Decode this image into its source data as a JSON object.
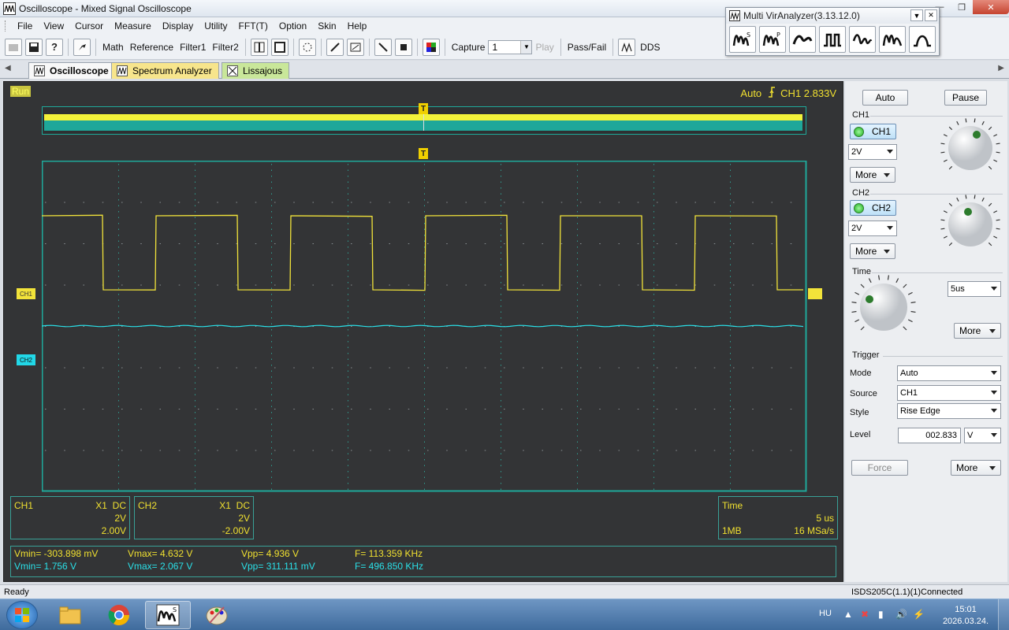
{
  "window": {
    "title": "Oscilloscope - Mixed Signal Oscilloscope"
  },
  "menu": [
    "File",
    "View",
    "Cursor",
    "Measure",
    "Display",
    "Utility",
    "FFT(T)",
    "Option",
    "Skin",
    "Help"
  ],
  "toolbar": {
    "math": "Math",
    "reference": "Reference",
    "filter1": "Filter1",
    "filter2": "Filter2",
    "capture_label": "Capture",
    "capture_value": "1",
    "play": "Play",
    "passfail": "Pass/Fail",
    "dds": "DDS"
  },
  "vir": {
    "title": "Multi VirAnalyzer(3.13.12.0)"
  },
  "tabs": [
    "Oscilloscope",
    "Spectrum Analyzer",
    "Lissajous"
  ],
  "scope": {
    "run": "Run",
    "trigger_mode": "Auto",
    "trigger_info": "CH1 2.833V",
    "ch1_tag": "CH1",
    "ch2_tag": "CH2",
    "trig_marker": "T"
  },
  "ch1_box": {
    "name": "CH1",
    "probe": "X1",
    "coupling": "DC",
    "scale": "2V",
    "offset": "2.00V"
  },
  "ch2_box": {
    "name": "CH2",
    "probe": "X1",
    "coupling": "DC",
    "scale": "2V",
    "offset": "-2.00V"
  },
  "time_box": {
    "label": "Time",
    "scale": "5 us",
    "memory": "1MB",
    "rate": "16 MSa/s"
  },
  "measurements": {
    "ch1": {
      "vmin": "Vmin= -303.898 mV",
      "vmax": "Vmax= 4.632 V",
      "vpp": "Vpp= 4.936 V",
      "freq": "F= 113.359 KHz"
    },
    "ch2": {
      "vmin": "Vmin= 1.756 V",
      "vmax": "Vmax= 2.067 V",
      "vpp": "Vpp= 311.111 mV",
      "freq": "F= 496.850 KHz"
    }
  },
  "panel": {
    "auto": "Auto",
    "pause": "Pause",
    "ch1_label": "CH1",
    "ch1_btn": "CH1",
    "ch1_scale": "2V",
    "ch2_label": "CH2",
    "ch2_btn": "CH2",
    "ch2_scale": "2V",
    "more": "More",
    "time_label": "Time",
    "time_scale": "5us",
    "trigger_label": "Trigger",
    "mode_label": "Mode",
    "mode_value": "Auto",
    "source_label": "Source",
    "source_value": "CH1",
    "style_label": "Style",
    "style_value": "Rise Edge",
    "level_label": "Level",
    "level_value": "002.833",
    "level_unit": "V",
    "force": "Force"
  },
  "status": {
    "left": "Ready",
    "right": "ISDS205C(1.1)(1)Connected"
  },
  "taskbar": {
    "lang": "HU",
    "time": "15:01",
    "date": "2026.03.24."
  },
  "colors": {
    "ch1": "#f2e33a",
    "ch2": "#2ae0e8",
    "grid": "#1fa89a",
    "scope_bg": "#333436"
  }
}
